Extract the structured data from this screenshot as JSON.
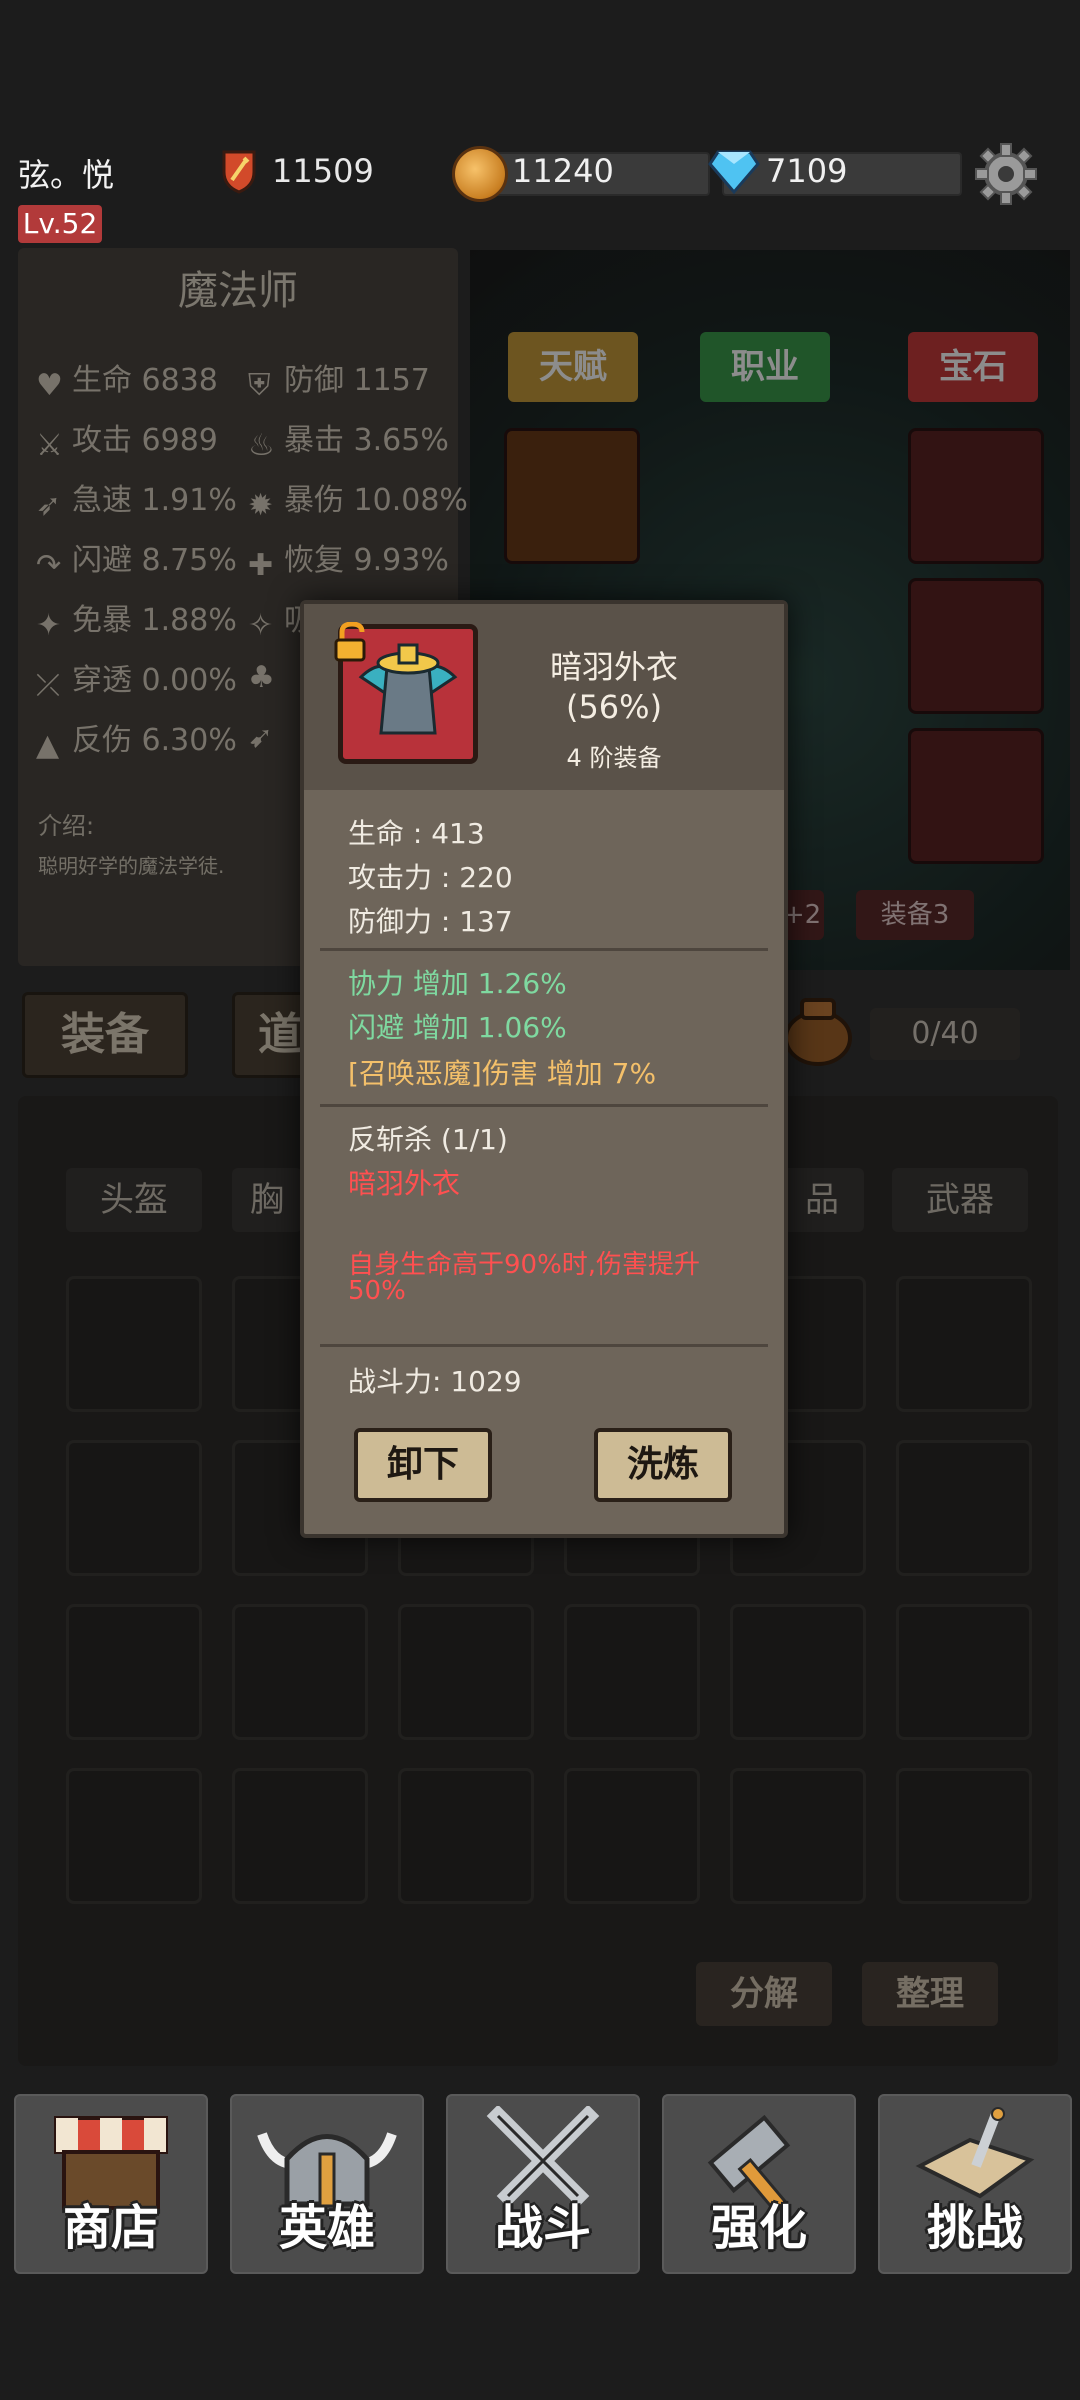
{
  "player": {
    "name": "弦。悦",
    "level": "Lv.52",
    "power": "11509",
    "coins": "11240",
    "gems": "7109"
  },
  "character": {
    "class_name": "魔法师",
    "stats": [
      {
        "label": "生命",
        "value": "6838"
      },
      {
        "label": "防御",
        "value": "1157"
      },
      {
        "label": "攻击",
        "value": "6989"
      },
      {
        "label": "暴击",
        "value": "3.65%"
      },
      {
        "label": "急速",
        "value": "1.91%"
      },
      {
        "label": "暴伤",
        "value": "10.08%"
      },
      {
        "label": "闪避",
        "value": "8.75%"
      },
      {
        "label": "恢复",
        "value": "9.93%"
      },
      {
        "label": "免暴",
        "value": "1.88%"
      },
      {
        "label": "吸",
        "value": ""
      },
      {
        "label": "穿透",
        "value": "0.00%"
      },
      {
        "label": "",
        "value": ""
      },
      {
        "label": "反伤",
        "value": "6.30%"
      },
      {
        "label": "",
        "value": ""
      }
    ],
    "intro_label": "介绍:",
    "intro_text": "聪明好学的魔法学徒."
  },
  "equip_tabs": {
    "talent": "天赋",
    "job": "职业",
    "gem": "宝石",
    "equip2": "+2",
    "equip3": "装备3"
  },
  "bag": {
    "tab_equip": "装备",
    "tab_items": "道",
    "count": "0/40",
    "categories": [
      "头盔",
      "胸",
      "品",
      "武器"
    ],
    "decompose": "分解",
    "sort": "整理"
  },
  "nav": [
    {
      "label": "商店",
      "icon": "shop-icon"
    },
    {
      "label": "英雄",
      "icon": "helmet-icon"
    },
    {
      "label": "战斗",
      "icon": "crossed-swords-icon"
    },
    {
      "label": "强化",
      "icon": "hammer-icon"
    },
    {
      "label": "挑战",
      "icon": "map-sword-icon"
    }
  ],
  "tooltip": {
    "item_name": "暗羽外衣",
    "quality_pct": "(56%)",
    "tier": "4 阶装备",
    "base_stats": [
      "生命 : 413",
      "攻击力 : 220",
      "防御力 : 137"
    ],
    "bonus_stats": [
      {
        "text": "协力 增加 1.26%",
        "color": "green"
      },
      {
        "text": "闪避 增加 1.06%",
        "color": "green"
      },
      {
        "text": "[召唤恶魔]伤害 增加 7%",
        "color": "gold"
      }
    ],
    "set_name": "反斩杀 (1/1)",
    "set_piece": "暗羽外衣",
    "set_effect_line1": "自身生命高于90%时,伤害提升",
    "set_effect_line2": "50%",
    "combat_power": "战斗力: 1029",
    "unequip_button": "卸下",
    "reforge_button": "洗炼"
  },
  "colors": {
    "accent_red": "#b23a3a",
    "green_text": "#7fd9a0",
    "gold_text": "#f4c06a",
    "red_text": "#ff5050"
  }
}
